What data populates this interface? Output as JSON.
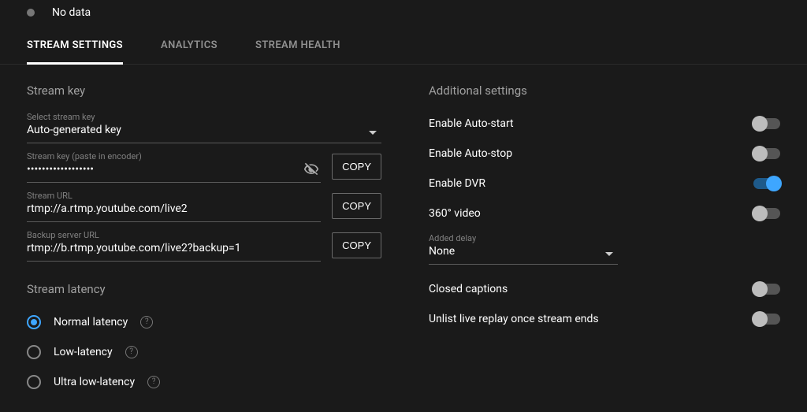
{
  "top": {
    "status_text": "No data"
  },
  "tabs": {
    "stream_settings": "STREAM SETTINGS",
    "analytics": "ANALYTICS",
    "stream_health": "STREAM HEALTH"
  },
  "stream_key": {
    "section_title": "Stream key",
    "select_label": "Select stream key",
    "select_value": "Auto-generated key",
    "key_label": "Stream key (paste in encoder)",
    "key_value": "••••••••••••••••••",
    "url_label": "Stream URL",
    "url_value": "rtmp://a.rtmp.youtube.com/live2",
    "backup_label": "Backup server URL",
    "backup_value": "rtmp://b.rtmp.youtube.com/live2?backup=1",
    "copy_label": "COPY"
  },
  "latency": {
    "section_title": "Stream latency",
    "normal": "Normal latency",
    "low": "Low-latency",
    "ultra": "Ultra low-latency"
  },
  "additional": {
    "section_title": "Additional settings",
    "auto_start": "Enable Auto-start",
    "auto_stop": "Enable Auto-stop",
    "dvr": "Enable DVR",
    "video360": "360° video",
    "delay_label": "Added delay",
    "delay_value": "None",
    "closed_captions": "Closed captions",
    "unlist_replay": "Unlist live replay once stream ends"
  },
  "toggles": {
    "auto_start": false,
    "auto_stop": false,
    "dvr": true,
    "video360": false,
    "closed_captions": false,
    "unlist_replay": false
  }
}
